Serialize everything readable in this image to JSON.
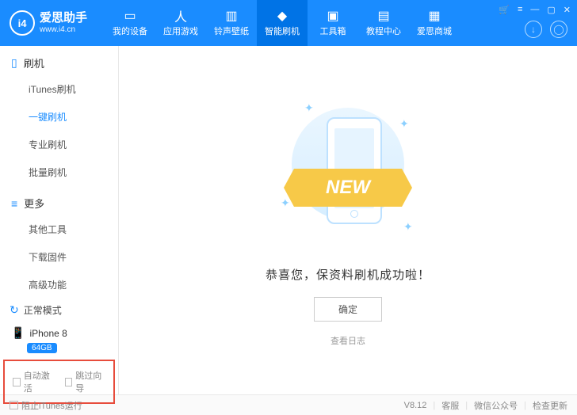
{
  "header": {
    "logo_text": "i4",
    "app_name": "爱思助手",
    "url": "www.i4.cn",
    "nav": [
      {
        "label": "我的设备"
      },
      {
        "label": "应用游戏"
      },
      {
        "label": "铃声壁纸"
      },
      {
        "label": "智能刷机"
      },
      {
        "label": "工具箱"
      },
      {
        "label": "教程中心"
      },
      {
        "label": "爱思商城"
      }
    ]
  },
  "sidebar": {
    "section_flash": "刷机",
    "flash_items": {
      "itunes": "iTunes刷机",
      "oneclick": "一键刷机",
      "pro": "专业刷机",
      "batch": "批量刷机"
    },
    "section_more": "更多",
    "more_items": {
      "other_tools": "其他工具",
      "download_fw": "下载固件",
      "advanced": "高级功能"
    },
    "mode_label": "正常模式",
    "device_name": "iPhone 8",
    "device_storage": "64GB",
    "auto_activate": "自动激活",
    "skip_wizard": "跳过向导"
  },
  "main": {
    "ribbon": "NEW",
    "success": "恭喜您，保资料刷机成功啦！",
    "ok": "确定",
    "view_log": "查看日志"
  },
  "footer": {
    "block_itunes": "阻止iTunes运行",
    "version": "V8.12",
    "support": "客服",
    "wechat": "微信公众号",
    "check_update": "检查更新"
  }
}
